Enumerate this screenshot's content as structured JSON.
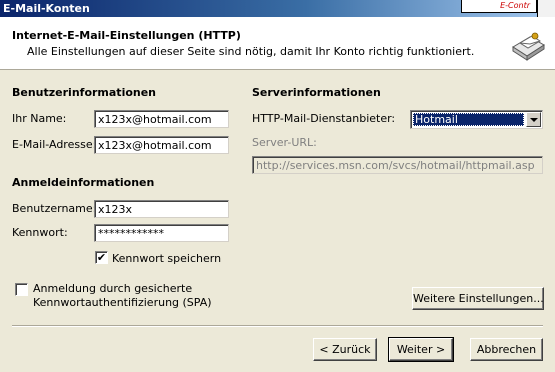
{
  "window": {
    "title": "E-Mail-Konten",
    "title_deco": "E-Contr"
  },
  "header": {
    "title": "Internet-E-Mail-Einstellungen (HTTP)",
    "subtitle": "Alle Einstellungen auf dieser Seite sind nötig, damit Ihr Konto richtig funktioniert.",
    "icon": "envelope-card-icon"
  },
  "user_info": {
    "heading": "Benutzerinformationen",
    "name_label": "Ihr Name:",
    "name_value": "x123x@hotmail.com",
    "email_label": "E-Mail-Adresse:",
    "email_value": "x123x@hotmail.com"
  },
  "login_info": {
    "heading": "Anmeldeinformationen",
    "user_label": "Benutzername:",
    "user_value": "x123x",
    "password_label": "Kennwort:",
    "password_value": "************",
    "save_password_label": "Kennwort speichern",
    "save_password_checked": true,
    "save_password_mark": "✔"
  },
  "spa": {
    "label_line1": "Anmeldung durch gesicherte",
    "label_line2": "Kennwortauthentifizierung (SPA)",
    "checked": false
  },
  "server_info": {
    "heading": "Serverinformationen",
    "provider_label": "HTTP-Mail-Dienstanbieter:",
    "provider_value": "Hotmail",
    "url_label": "Server-URL:",
    "url_value": "http://services.msn.com/svcs/hotmail/httpmail.asp"
  },
  "buttons": {
    "more_settings": "Weitere Einstellungen...",
    "back": "< Zurück",
    "next": "Weiter >",
    "cancel": "Abbrechen"
  },
  "colors": {
    "face": "#ece9d8",
    "selection": "#0a246a",
    "title_gradient_start": "#0a246a"
  }
}
